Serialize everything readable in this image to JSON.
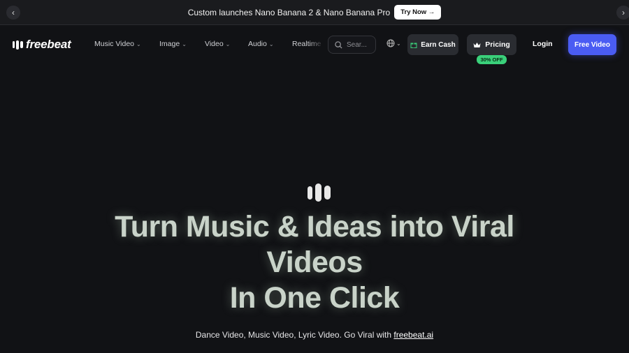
{
  "announcement": {
    "message": "Custom launches Nano Banana 2 & Nano Banana Pro",
    "cta": "Try Now →",
    "prev_icon": "chevron-left-icon",
    "next_icon": "chevron-right-icon"
  },
  "brand": {
    "name": "freebeat",
    "accent": "#4a5cf3",
    "badge_green": "#3ad07a"
  },
  "nav": {
    "items": [
      {
        "label": "Music Video"
      },
      {
        "label": "Image"
      },
      {
        "label": "Video"
      },
      {
        "label": "Audio"
      },
      {
        "label": "Realtime"
      }
    ],
    "search_placeholder": "Sear...",
    "earn_cash": "Earn Cash",
    "pricing": "Pricing",
    "pricing_badge": "30% OFF",
    "login": "Login",
    "free_video": "Free Video"
  },
  "hero": {
    "line1": "Turn Music & Ideas into Viral",
    "line2": "Videos",
    "line3": "In One Click",
    "subtitle": "Dance Video, Music Video, Lyric Video. Go Viral with ",
    "subtitle_link": "freebeat.ai"
  }
}
